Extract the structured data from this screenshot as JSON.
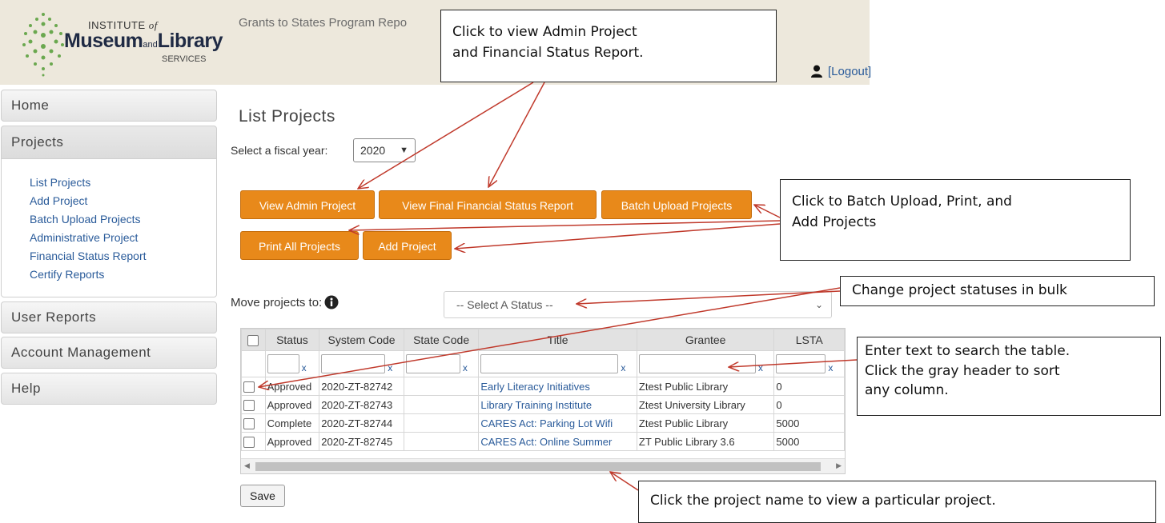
{
  "header": {
    "logo_institute": "INSTITUTE",
    "logo_of": "of",
    "logo_museum": "Museum",
    "logo_and": "and",
    "logo_library": "Library",
    "logo_services": "SERVICES",
    "app_title": "Grants to States Program Repo",
    "logout": "[Logout]",
    "user_icon": "user-icon"
  },
  "sidebar": {
    "home": "Home",
    "projects": "Projects",
    "sub_items": [
      "List Projects",
      "Add Project",
      "Batch Upload Projects",
      "Administrative Project",
      "Financial Status Report",
      "Certify Reports"
    ],
    "user_reports": "User Reports",
    "account_management": "Account Management",
    "help": "Help"
  },
  "main": {
    "title": "List Projects",
    "fiscal_label": "Select a fiscal year:",
    "fiscal_value": "2020",
    "buttons": {
      "admin": "View Admin Project",
      "ffsr": "View Final Financial Status Report",
      "batch": "Batch Upload Projects",
      "print": "Print All Projects",
      "add": "Add Project"
    },
    "move_label": "Move projects to:",
    "status_placeholder": "-- Select A Status --",
    "save": "Save"
  },
  "table": {
    "headers": [
      "Status",
      "System Code",
      "State Code",
      "Title",
      "Grantee",
      "LSTA"
    ],
    "filter_clear": "x",
    "rows": [
      {
        "status": "Approved",
        "system_code": "2020-ZT-82742",
        "state_code": "",
        "title": "Early Literacy Initiatives",
        "grantee": "Ztest Public Library",
        "lsta": "0"
      },
      {
        "status": "Approved",
        "system_code": "2020-ZT-82743",
        "state_code": "",
        "title": "Library Training Institute",
        "grantee": "Ztest University Library",
        "lsta": "0"
      },
      {
        "status": "Complete",
        "system_code": "2020-ZT-82744",
        "state_code": "",
        "title": "CARES Act: Parking Lot Wifi",
        "grantee": "Ztest Public Library",
        "lsta": "5000"
      },
      {
        "status": "Approved",
        "system_code": "2020-ZT-82745",
        "state_code": "",
        "title": "CARES Act: Online Summer",
        "grantee": "ZT Public Library 3.6",
        "lsta": "5000"
      }
    ]
  },
  "callouts": {
    "c1_line1": "Click to view Admin Project",
    "c1_line2": "and Financial Status Report.",
    "c2_line1": "Click to Batch Upload, Print, and",
    "c2_line2": "Add Projects",
    "c3": "Change project statuses in bulk",
    "c4_line1": "Enter text to search the table.",
    "c4_line2": "Click the gray header to sort",
    "c4_line3": "any column.",
    "c5": "Click the project name to view a particular project."
  },
  "colors": {
    "header_bg": "#ede8dc",
    "button_orange": "#e8891a",
    "link_blue": "#2a5b9a",
    "arrow_red": "#c0392b"
  }
}
